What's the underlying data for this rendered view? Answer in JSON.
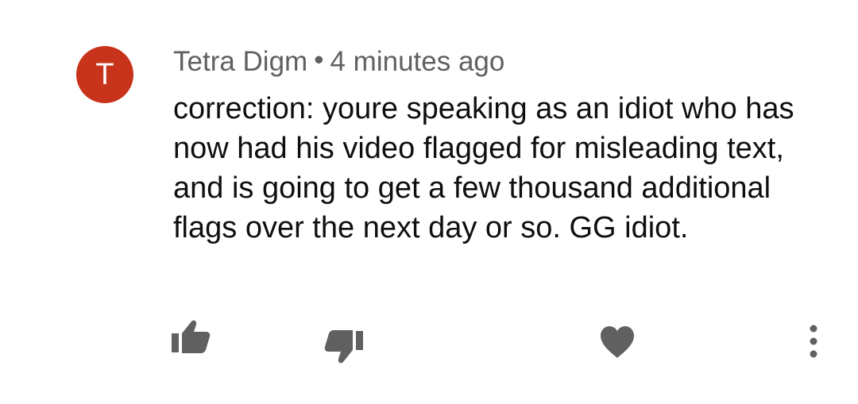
{
  "comment": {
    "avatar_letter": "T",
    "avatar_color": "#c8341b",
    "author": "Tetra Digm",
    "separator": "•",
    "time": "4 minutes ago",
    "text": "correction: youre speaking as an idiot who has now had his video flagged for misleading text, and is going to get a few thousand additional flags over the next day or so. GG idiot."
  },
  "actions": {
    "like_icon": "thumbs-up-icon",
    "dislike_icon": "thumbs-down-icon",
    "heart_icon": "heart-icon",
    "more_icon": "more-vert-icon"
  }
}
